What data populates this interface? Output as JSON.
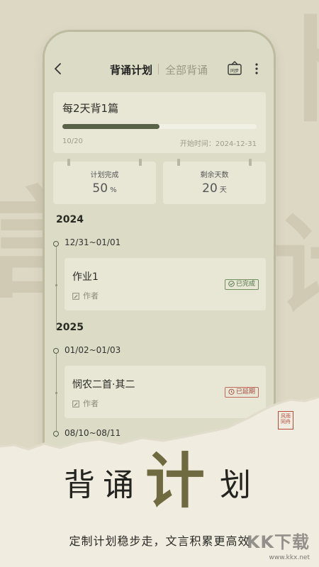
{
  "colors": {
    "accent": "#596247",
    "done": "#4d7040",
    "late": "#a5473a",
    "seal": "#b64a3a"
  },
  "header": {
    "tab_active": "背诵计划",
    "tab_inactive": "全部背诵",
    "sync_label": "同步",
    "icons": [
      "back-icon",
      "sync-icon",
      "more-icon"
    ]
  },
  "plan": {
    "title": "每2天背1篇",
    "progress_fraction": 0.5,
    "progress_text": "10/20",
    "start_label": "开始时间：2024-12-31"
  },
  "stats": {
    "completion": {
      "label": "计划完成",
      "value": "50",
      "unit": "%"
    },
    "remaining": {
      "label": "剩余天数",
      "value": "20",
      "unit": "天"
    }
  },
  "timeline": [
    {
      "year": "2024",
      "range": "12/31~01/01",
      "title": "作业1",
      "author": "作者",
      "status": "已完成"
    },
    {
      "year": "2025",
      "range": "01/02~01/03",
      "title": "悯农二首·其二",
      "author": "作者",
      "status": "已延期"
    },
    {
      "range": "08/10~08/11"
    }
  ],
  "promo": {
    "headline_1": "背",
    "headline_2": "诵",
    "headline_3": "计",
    "headline_4": "划",
    "subtitle": "定制计划稳步走，文言积累更高效",
    "seal_text": "风雨同舟"
  },
  "watermark": {
    "text": "KK下载",
    "url": "www.kkx.net"
  }
}
